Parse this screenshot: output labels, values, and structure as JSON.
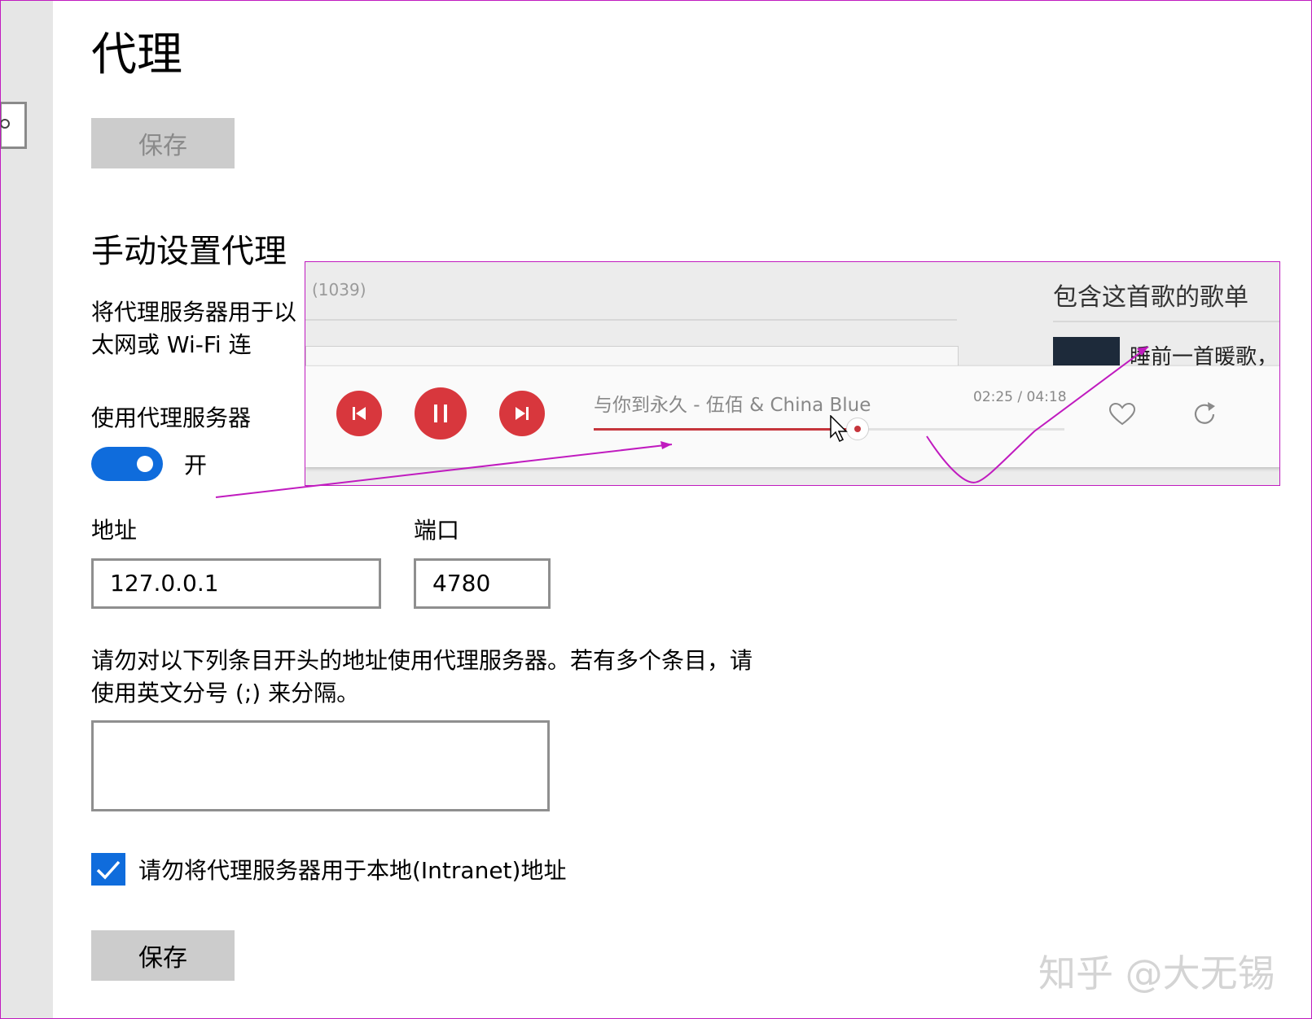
{
  "page": {
    "title": "代理",
    "save_top_label": "保存",
    "manual_heading": "手动设置代理",
    "manual_desc": "将代理服务器用于以太网或 Wi-Fi 连接。",
    "use_proxy_label": "使用代理服务器",
    "toggle_state_label": "开",
    "toggle_on": true,
    "address_label": "地址",
    "address_value": "127.0.0.1",
    "port_label": "端口",
    "port_value": "4780",
    "exceptions_desc_line1": "请勿对以下列条目开头的地址使用代理服务器。若有多个条目，请",
    "exceptions_desc_line2": "使用英文分号 (;) 来分隔。",
    "exceptions_value": "",
    "local_checkbox_label": "请勿将代理服务器用于本地(Intranet)地址",
    "local_checkbox_checked": true,
    "save_bottom_label": "保存"
  },
  "player": {
    "comment_count": "(1039)",
    "playlist_title": "包含这首歌的歌单",
    "playlist_item": "睡前一首暖歌，",
    "song_title": "与你到永久",
    "song_sep": " - ",
    "song_artist": "伍佰 & China Blue",
    "time_current": "02:25",
    "time_sep": " / ",
    "time_total": "04:18",
    "progress": 0.56,
    "accent_color": "#d8373d",
    "icons": [
      "prev-icon",
      "pause-icon",
      "next-icon",
      "heart-icon",
      "loop-icon"
    ]
  },
  "watermark": "知乎 @大无锡",
  "colors": {
    "toggle_blue": "#0f6cdc",
    "annotation_magenta": "#c01bbf",
    "button_gray": "#cccccc"
  }
}
